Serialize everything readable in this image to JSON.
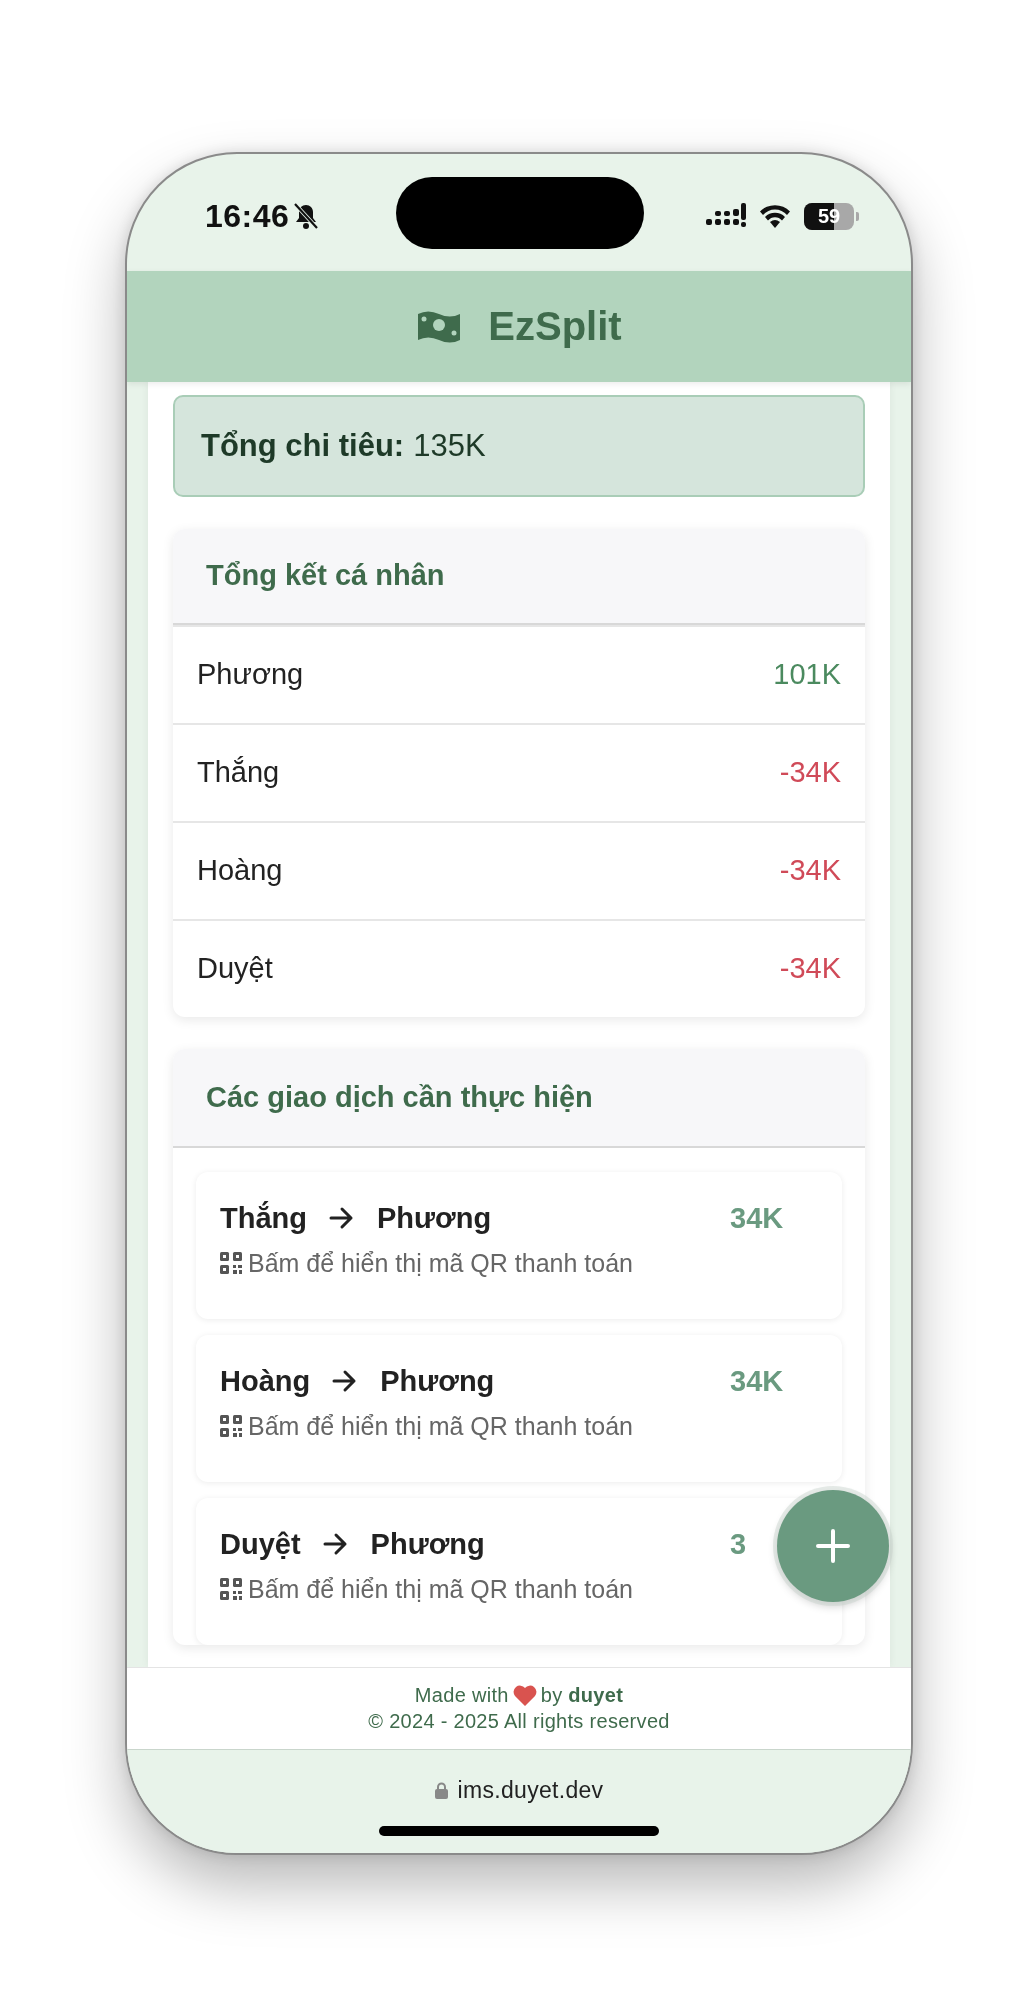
{
  "status_bar": {
    "time": "16:46",
    "battery": "59"
  },
  "header": {
    "title": "EzSplit"
  },
  "total": {
    "label": "Tổng chi tiêu:",
    "value": "135K"
  },
  "summary": {
    "title": "Tổng kết cá nhân",
    "rows": [
      {
        "name": "Phương",
        "amount": "101K",
        "kind": "positive"
      },
      {
        "name": "Thắng",
        "amount": "-34K",
        "kind": "negative"
      },
      {
        "name": "Hoàng",
        "amount": "-34K",
        "kind": "negative"
      },
      {
        "name": "Duyệt",
        "amount": "-34K",
        "kind": "negative"
      }
    ]
  },
  "transactions": {
    "title": "Các giao dịch cần thực hiện",
    "items": [
      {
        "from": "Thắng",
        "to": "Phương",
        "amount": "34K",
        "hint": "Bấm để hiển thị mã QR thanh toán"
      },
      {
        "from": "Hoàng",
        "to": "Phương",
        "amount": "34K",
        "hint": "Bấm để hiển thị mã QR thanh toán"
      },
      {
        "from": "Duyệt",
        "to": "Phương",
        "amount": "3",
        "hint": "Bấm để hiển thị mã QR thanh toán"
      }
    ]
  },
  "footer": {
    "made_with": "Made with",
    "by_line": "by **duyet**",
    "copyright": "© 2024 - 2025 All rights reserved"
  },
  "address_bar": {
    "url": "ims.duyet.dev"
  }
}
